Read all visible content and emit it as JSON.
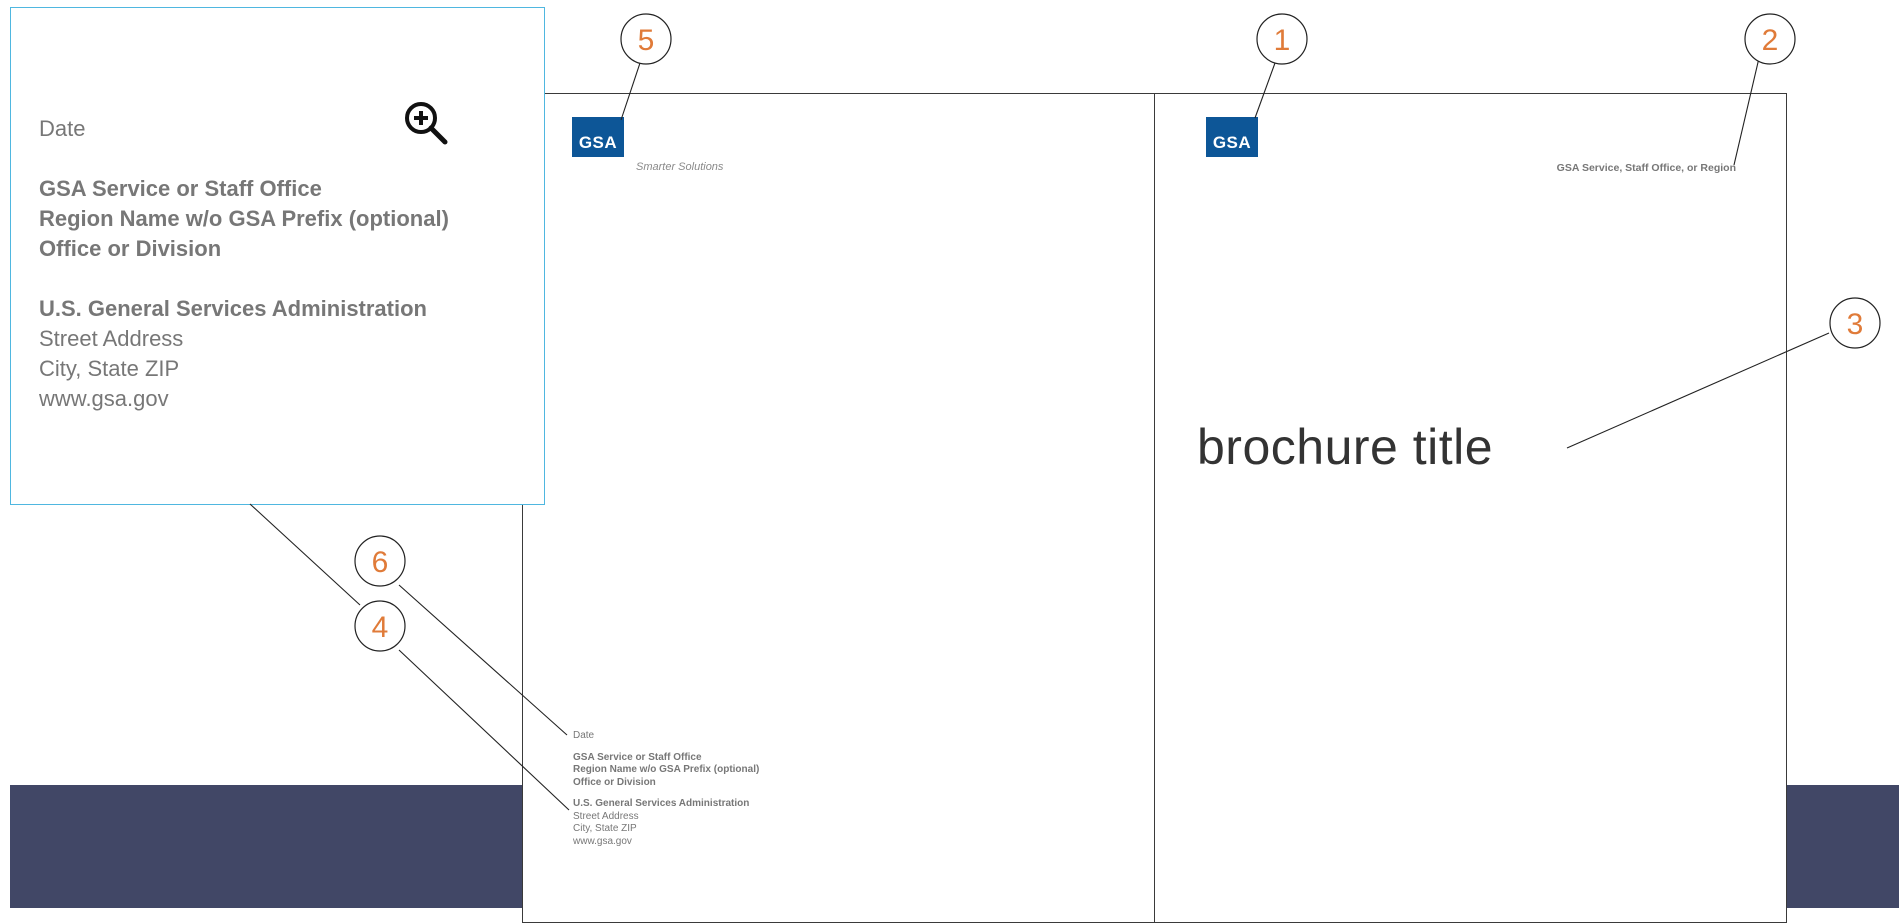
{
  "colors": {
    "brand_blue": "#0d5697",
    "dark_band": "#414766",
    "callout_number": "#e07b39",
    "zoom_border": "#4fb7e0",
    "text_gray": "#777777"
  },
  "left_panel": {
    "logo_text": "GSA",
    "tagline": "Smarter Solutions",
    "address": {
      "date": "Date",
      "service": "GSA Service or Staff Office",
      "region": "Region Name w/o GSA Prefix (optional)",
      "office": "Office or Division",
      "agency": "U.S. General Services Administration",
      "street": "Street Address",
      "city": "City, State ZIP",
      "web": "www.gsa.gov"
    }
  },
  "right_panel": {
    "logo_text": "GSA",
    "service_label": "GSA Service, Staff Office, or Region",
    "title": "brochure title"
  },
  "zoom_panel": {
    "icon": "zoom-in-icon",
    "address": {
      "date": "Date",
      "service": "GSA Service or Staff Office",
      "region": "Region Name w/o GSA Prefix (optional)",
      "office": "Office or Division",
      "agency": "U.S. General Services Administration",
      "street": "Street Address",
      "city": "City, State ZIP",
      "web": "www.gsa.gov"
    }
  },
  "callouts": [
    "1",
    "2",
    "3",
    "4",
    "5",
    "6"
  ]
}
